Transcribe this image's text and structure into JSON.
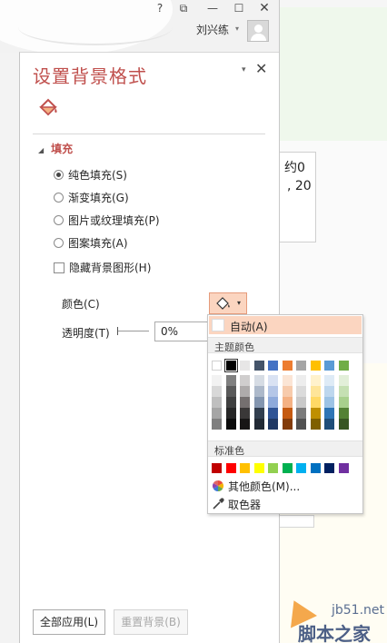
{
  "window": {
    "help": "?",
    "restore": "⧉",
    "minimize": "—",
    "maximize": "☐",
    "close": "✕",
    "user_name": "刘兴练",
    "user_caret": "▾"
  },
  "document": {
    "line1": "约0",
    "line2": ", 20"
  },
  "pane": {
    "title": "设置背景格式",
    "dropdown_caret": "▾",
    "close": "✕",
    "section_arrow": "◢",
    "section": "填充",
    "fill_options": [
      {
        "label": "纯色填充(S)",
        "selected": true
      },
      {
        "label": "渐变填充(G)",
        "selected": false
      },
      {
        "label": "图片或纹理填充(P)",
        "selected": false
      },
      {
        "label": "图案填充(A)",
        "selected": false
      }
    ],
    "hide_bg_graphics": "隐藏背景图形(H)",
    "color_label": "颜色(C)",
    "color_caret": "▾",
    "transparency_label": "透明度(T)",
    "transparency_value": "0%",
    "apply_all": "全部应用(L)",
    "reset_bg": "重置背景(B)"
  },
  "color_menu": {
    "automatic": "自动(A)",
    "theme_colors_header": "主题颜色",
    "standard_colors_header": "标准色",
    "more_colors": "其他颜色(M)...",
    "eyedropper": "取色器",
    "theme_top": [
      "#FFFFFF",
      "#000000",
      "#E7E6E6",
      "#44546A",
      "#4472C4",
      "#ED7D31",
      "#A5A5A5",
      "#FFC000",
      "#5B9BD5",
      "#70AD47"
    ],
    "theme_shades": [
      [
        "#F2F2F2",
        "#7F7F7F",
        "#D0CECE",
        "#D6DCE4",
        "#D9E2F3",
        "#FBE5D5",
        "#EDEDED",
        "#FFF2CC",
        "#DEEBF6",
        "#E2EFD9"
      ],
      [
        "#D8D8D8",
        "#595959",
        "#AEABAB",
        "#ADB9CA",
        "#B4C6E7",
        "#F7CBAC",
        "#DBDBDB",
        "#FEE599",
        "#BDD7EE",
        "#C5E0B3"
      ],
      [
        "#BFBFBF",
        "#3F3F3F",
        "#757070",
        "#8496B0",
        "#8EAADB",
        "#F4B183",
        "#C9C9C9",
        "#FFD965",
        "#9CC3E5",
        "#A8D08D"
      ],
      [
        "#A5A5A5",
        "#262626",
        "#3A3838",
        "#323F4F",
        "#2F5496",
        "#C55A11",
        "#7B7B7B",
        "#BF8F00",
        "#2E75B5",
        "#538135"
      ],
      [
        "#7F7F7F",
        "#0C0C0C",
        "#171616",
        "#222A35",
        "#1F3864",
        "#833C0B",
        "#525252",
        "#7F6000",
        "#1E4E79",
        "#375623"
      ]
    ],
    "standard": [
      "#C00000",
      "#FF0000",
      "#FFC000",
      "#FFFF00",
      "#92D050",
      "#00B050",
      "#00B0F0",
      "#0070C0",
      "#002060",
      "#7030A0"
    ]
  },
  "watermark": {
    "line1": "jb51.net",
    "line2": "脚本之家"
  }
}
